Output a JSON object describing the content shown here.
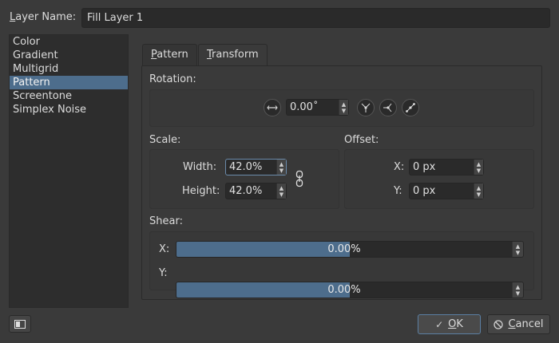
{
  "layer_name": {
    "label": "Layer Name:",
    "value": "Fill Layer 1"
  },
  "fill_types": [
    "Color",
    "Gradient",
    "Multigrid",
    "Pattern",
    "Screentone",
    "Simplex Noise"
  ],
  "selected_fill_type": "Pattern",
  "tabs": [
    {
      "label": "Pattern",
      "active": false
    },
    {
      "label": "Transform",
      "active": true
    }
  ],
  "rotation": {
    "title": "Rotation:",
    "value": "0.00˚"
  },
  "scale": {
    "title": "Scale:",
    "width_label": "Width:",
    "width_value": "42.0%",
    "height_label": "Height:",
    "height_value": "42.0%"
  },
  "offset": {
    "title": "Offset:",
    "x_label": "X:",
    "x_value": "0 px",
    "y_label": "Y:",
    "y_value": "0 px"
  },
  "shear": {
    "title": "Shear:",
    "x_label": "X:",
    "x_value": "0.00%",
    "x_fill": 0.5,
    "y_label": "Y:",
    "y_value": "0.00%",
    "y_fill": 0.5
  },
  "buttons": {
    "ok": "OK",
    "cancel": "Cancel"
  },
  "icons": {
    "rotation_dial": "dial-icon",
    "mirror_vertical": "mirror-vertical-icon",
    "mirror_left": "mirror-left-icon",
    "mirror_diagonal": "mirror-diagonal-icon",
    "chain": "chain-link-icon",
    "panel": "panel-toggle-icon",
    "ok": "check-icon",
    "cancel": "cancel-icon"
  },
  "colors": {
    "accent": "#4d6d8c",
    "background": "#3a3a3a",
    "field": "#2a2a2a"
  }
}
